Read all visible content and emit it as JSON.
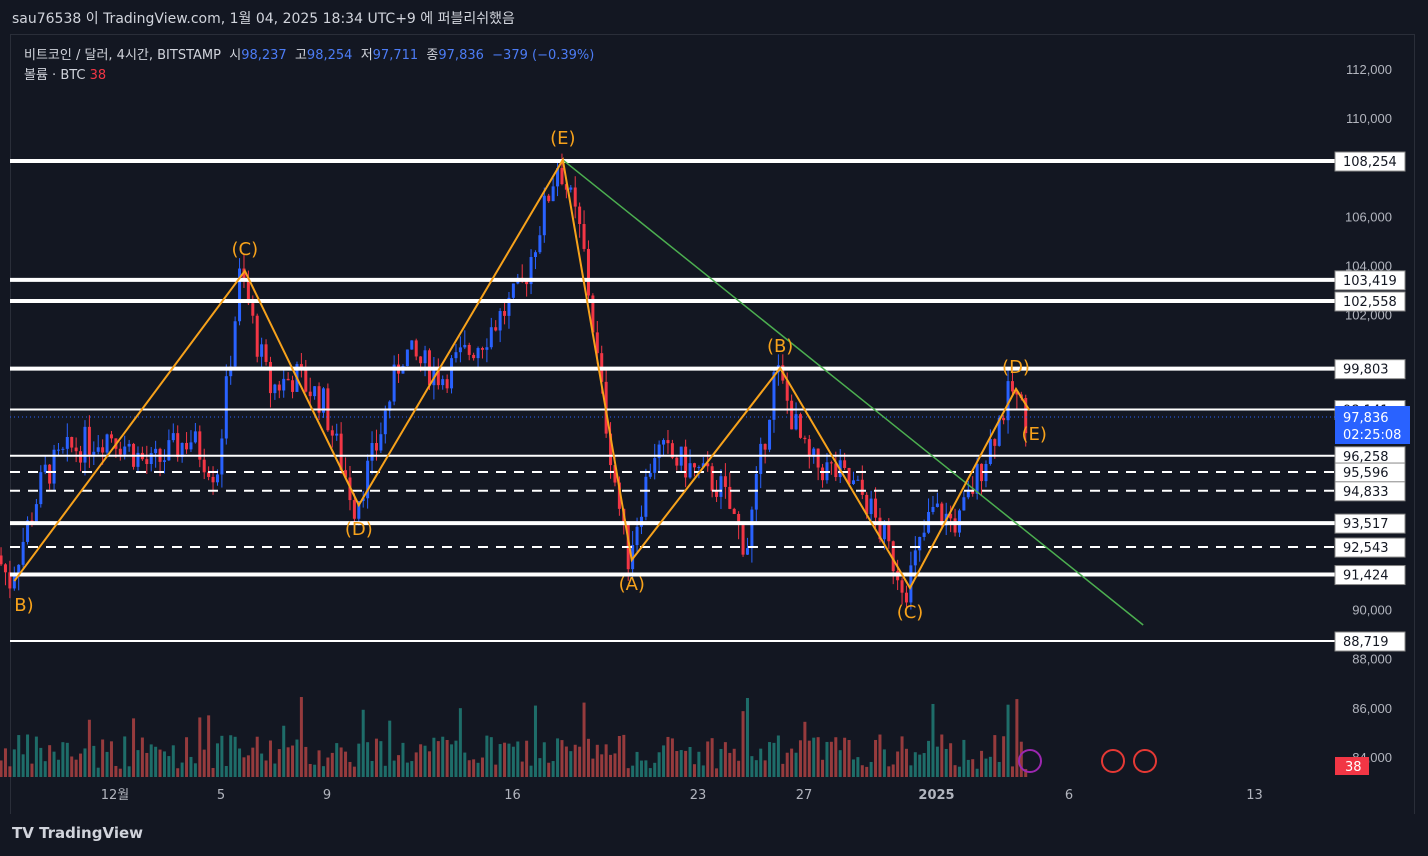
{
  "header": {
    "published": "sau76538 이 TradingView.com, 1월 04, 2025 18:34 UTC+9 에 퍼블리쉬했음"
  },
  "legend": {
    "symbol": "비트코인 / 달러, 4시간, BITSTAMP",
    "o_label": "시",
    "open": "98,237",
    "h_label": "고",
    "high": "98,254",
    "l_label": "저",
    "low": "97,711",
    "c_label": "종",
    "close": "97,836",
    "change": "−379 (−0.39%)",
    "volume_label": "볼륨 · BTC",
    "volume": "38"
  },
  "footer": {
    "brand": "TradingView"
  },
  "colors": {
    "up": "#2962ff",
    "down": "#f23645",
    "pattern": "#f7a21b",
    "trend": "#4caf50",
    "level": "#ffffff",
    "vol_up": "#26a69a",
    "vol_down": "#ef5350"
  },
  "chart_data": {
    "type": "candlestick",
    "ylim": [
      84000,
      112000
    ],
    "y_ticks": [
      84000,
      86000,
      88000,
      90000,
      102000,
      104000,
      106000,
      110000,
      112000
    ],
    "x_ticks": [
      {
        "day": 0,
        "label": "12월"
      },
      {
        "day": 4,
        "label": "5"
      },
      {
        "day": 8,
        "label": "9"
      },
      {
        "day": 15,
        "label": "16"
      },
      {
        "day": 22,
        "label": "23"
      },
      {
        "day": 26,
        "label": "27"
      },
      {
        "day": 31,
        "label": "2025"
      },
      {
        "day": 36,
        "label": "6"
      },
      {
        "day": 43,
        "label": "13"
      }
    ],
    "levels": [
      {
        "price": 108254,
        "label": "108,254",
        "style": "thick"
      },
      {
        "price": 103419,
        "label": "103,419",
        "style": "thick"
      },
      {
        "price": 102558,
        "label": "102,558",
        "style": "thick"
      },
      {
        "price": 99803,
        "label": "99,803",
        "style": "thick"
      },
      {
        "price": 98141,
        "label": "98,141",
        "style": "thin"
      },
      {
        "price": 96258,
        "label": "96,258",
        "style": "thin"
      },
      {
        "price": 95596,
        "label": "95,596",
        "style": "dashed"
      },
      {
        "price": 94833,
        "label": "94,833",
        "style": "dashed"
      },
      {
        "price": 93517,
        "label": "93,517",
        "style": "thick"
      },
      {
        "price": 92543,
        "label": "92,543",
        "style": "dashed"
      },
      {
        "price": 91424,
        "label": "91,424",
        "style": "thick"
      },
      {
        "price": 88719,
        "label": "88,719",
        "style": "thin"
      }
    ],
    "current": {
      "price": 97836,
      "label": "97,836",
      "countdown": "02:25:08"
    },
    "volume_last": "38",
    "pattern": [
      {
        "day": -3.8,
        "price": 91160,
        "label": "B)"
      },
      {
        "day": 4.9,
        "price": 103780,
        "label": "(C)"
      },
      {
        "day": 9.2,
        "price": 94250,
        "label": "(D)"
      },
      {
        "day": 16.9,
        "price": 108300,
        "label": "(E)"
      },
      {
        "day": 19.5,
        "price": 92020,
        "label": "(A)"
      },
      {
        "day": 25.1,
        "price": 99830,
        "label": "(B)"
      },
      {
        "day": 30,
        "price": 90880,
        "label": "(C)"
      },
      {
        "day": 34,
        "price": 98980,
        "label": "(D)"
      },
      {
        "day": 34.5,
        "price": 98120,
        "label": "(E)"
      }
    ],
    "trendline": [
      {
        "day": 16.9,
        "price": 108300
      },
      {
        "day": 38.8,
        "price": 89370
      }
    ]
  }
}
